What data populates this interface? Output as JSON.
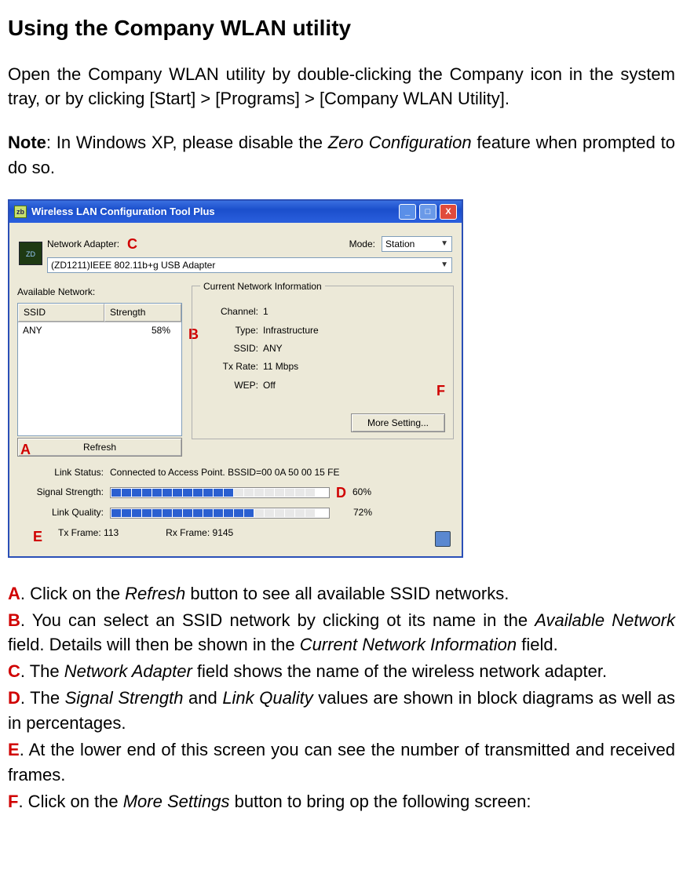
{
  "doc": {
    "title": "Using the Company WLAN utility",
    "intro": "Open the Company WLAN utility by double-clicking the Company icon in the system tray, or by clicking [Start] > [Programs] > [Company WLAN Utility].",
    "note_label": "Note",
    "note_before": ": In Windows XP, please disable the ",
    "note_italic": "Zero Configuration",
    "note_after": " feature when prompted to do so."
  },
  "win": {
    "title": "Wireless LAN Configuration Tool Plus",
    "system_min": "_",
    "system_max": "□",
    "system_close": "X",
    "network_adapter_label": "Network Adapter:",
    "mode_label": "Mode:",
    "mode_value": "Station",
    "adapter_value": "(ZD1211)IEEE 802.11b+g USB Adapter",
    "available_label": "Available Network:",
    "col_ssid": "SSID",
    "col_strength": "Strength",
    "rows": [
      {
        "ssid": "ANY",
        "strength": "58%"
      }
    ],
    "refresh": "Refresh",
    "curinfo_legend": "Current Network Information",
    "channel_k": "Channel:",
    "channel_v": "1",
    "type_k": "Type:",
    "type_v": "Infrastructure",
    "ssid_k": "SSID:",
    "ssid_v": "ANY",
    "txrate_k": "Tx Rate:",
    "txrate_v": "11 Mbps",
    "wep_k": "WEP:",
    "wep_v": "Off",
    "more_setting": "More Setting...",
    "link_status_k": "Link Status:",
    "link_status_v": "Connected to Access Point. BSSID=00 0A 50 00 15 FE",
    "sig_k": "Signal Strength:",
    "sig_pct": "60%",
    "qual_k": "Link Quality:",
    "qual_pct": "72%",
    "tx_frame_k": "Tx Frame:",
    "tx_frame_v": "113",
    "rx_frame_k": "Rx Frame:",
    "rx_frame_v": "9145"
  },
  "annot": {
    "A": "A",
    "B": "B",
    "C": "C",
    "D": "D",
    "E": "E",
    "F": "F"
  },
  "callouts": {
    "A_label": "A",
    "A_before": ". Click on the ",
    "A_i": "Refresh",
    "A_after": " button to see all available SSID networks.",
    "B_label": "B",
    "B_before": ". You can select an SSID network by clicking ot its name in the ",
    "B_i1": "Available Network",
    "B_mid": " field. Details will then be shown in the ",
    "B_i2": "Current Network Information",
    "B_after": " field.",
    "C_label": "C",
    "C_before": ". The ",
    "C_i": "Network Adapter",
    "C_after": " field shows the name of the wireless network adapter.",
    "D_label": "D",
    "D_before": ". The ",
    "D_i1": "Signal Strength",
    "D_mid": " and ",
    "D_i2": "Link Quality",
    "D_after": " values are shown in block diagrams as well as in percentages.",
    "E_label": "E",
    "E_text": ". At the lower end of this screen you can see the number of transmitted and received frames.",
    "F_label": "F",
    "F_before": ". Click on the ",
    "F_i": "More Settings",
    "F_after": " button to bring op the following screen:"
  }
}
